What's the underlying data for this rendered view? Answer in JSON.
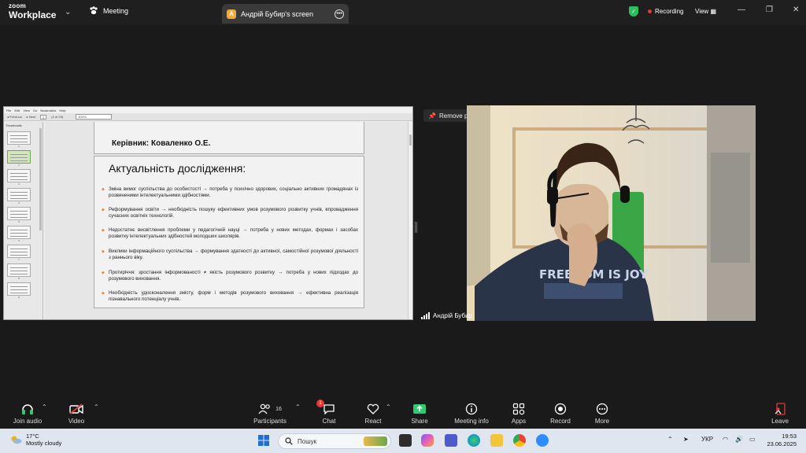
{
  "app": {
    "brand_line1": "zoom",
    "brand_line2": "Workplace",
    "meeting_label": "Meeting"
  },
  "screen_tab": {
    "avatar_letter": "А",
    "title": "Андрій Бубир's screen"
  },
  "status": {
    "recording": "Recording",
    "view": "View"
  },
  "shared_screen": {
    "menu": [
      "File",
      "Edit",
      "View",
      "Go",
      "Bookmarks",
      "Help"
    ],
    "toolbar": {
      "previous": "Previous",
      "next": "Next",
      "page_value": "2",
      "page_of": "(2 of 29)",
      "zoom": "100%"
    },
    "thumbnails_label": "Thumbnails",
    "thumb_numbers": [
      "1",
      "2",
      "3",
      "4",
      "5",
      "6",
      "7",
      "8",
      "9"
    ],
    "supervisor": "Керівник: Коваленко О.Е.",
    "slide_title": "Актуальність дослідження:",
    "bullets": [
      "Зміна вимог суспільства до особистості → потреба у психічно здорових, соціально активних громадянах із розвиненими інтелектуальними здібностями.",
      "Реформування освіти → необхідність пошуку ефективних умов розумового розвитку учнів, впровадження сучасних освітніх технологій.",
      "Недостатнє висвітлення проблеми у педагогічній науці → потреба у нових методах, формах і засобах розвитку інтелектуальних здібностей молодших школярів.",
      "Виклики інформаційного суспільства → формування здатності до активної, самостійної розумової діяльності з раннього віку.",
      "Протиріччя: зростання інформованості ≠ якість розумового розвитку → потреба у нових підходах до розумового виховання.",
      "Необхідність удосконалення змісту, форм і методів розумового виховання → ефективна реалізація пізнавального потенціалу учнів."
    ]
  },
  "pin": {
    "label": "Remove pin"
  },
  "video": {
    "participant_name": "Андрій Бубир",
    "shirt_text": "FREEDOM IS JOY"
  },
  "toolbar": {
    "join_audio": "Join audio",
    "video": "Video",
    "participants": "Participants",
    "participants_count": "16",
    "chat": "Chat",
    "chat_badge": "1",
    "react": "React",
    "share": "Share",
    "meeting_info": "Meeting info",
    "apps": "Apps",
    "record": "Record",
    "more": "More",
    "leave": "Leave"
  },
  "taskbar": {
    "temperature": "17°C",
    "weather": "Mostly cloudy",
    "search_placeholder": "Пошук",
    "language": "УКР",
    "time": "19:53",
    "date": "23.06.2025"
  },
  "colors": {
    "accent_green": "#2bbf5b",
    "record_red": "#e53935",
    "share_green": "#2ecc71",
    "bullet_orange": "#e28b2b"
  }
}
